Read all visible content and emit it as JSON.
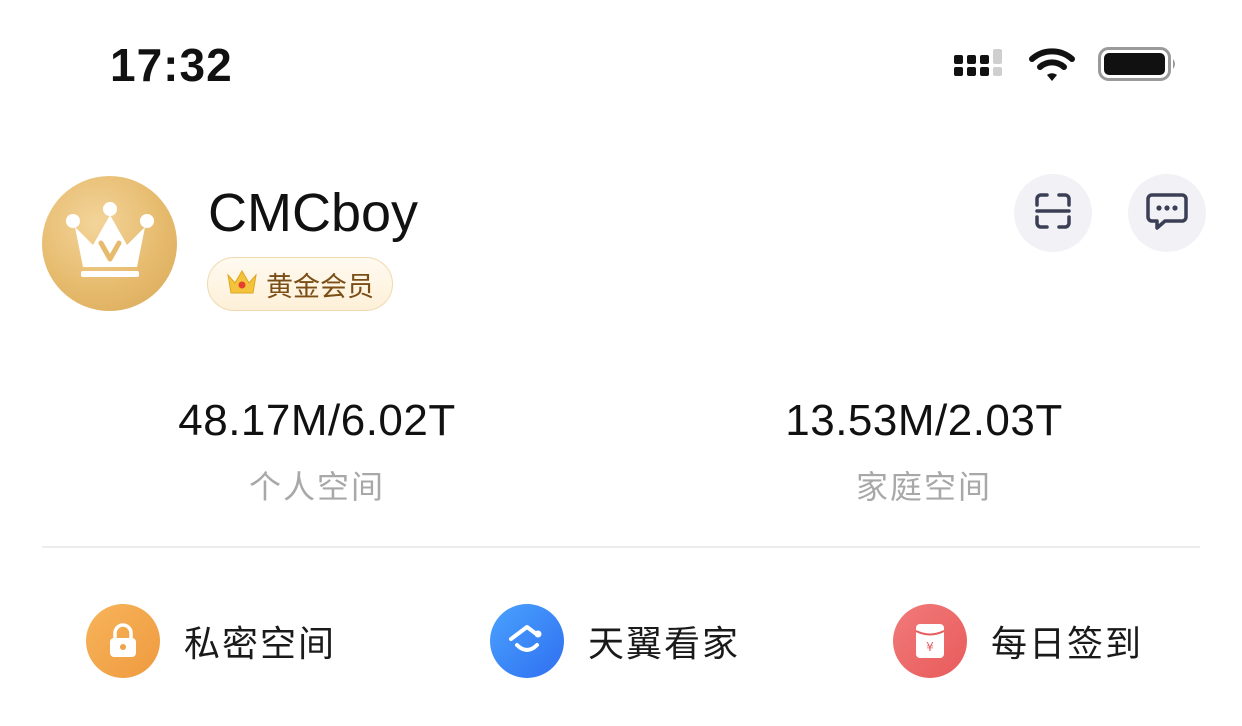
{
  "status_bar": {
    "time": "17:32",
    "icons": [
      "signal-icon",
      "wifi-icon",
      "battery-icon"
    ]
  },
  "profile": {
    "username": "CMCboy",
    "membership_label": "黄金会员",
    "avatar_icon": "crown-v-icon",
    "accent_gold": "#E6BB6E"
  },
  "header_actions": [
    {
      "name": "scan-icon"
    },
    {
      "name": "message-icon"
    }
  ],
  "storage": {
    "personal": {
      "value": "48.17M/6.02T",
      "label": "个人空间"
    },
    "family": {
      "value": "13.53M/2.03T",
      "label": "家庭空间"
    }
  },
  "features": [
    {
      "label": "私密空间",
      "icon": "lock-icon",
      "color": "#F2A54A"
    },
    {
      "label": "天翼看家",
      "icon": "home-camera-icon",
      "color": "#3E8BF7"
    },
    {
      "label": "每日签到",
      "icon": "red-envelope-icon",
      "color": "#EE6B6B"
    }
  ]
}
